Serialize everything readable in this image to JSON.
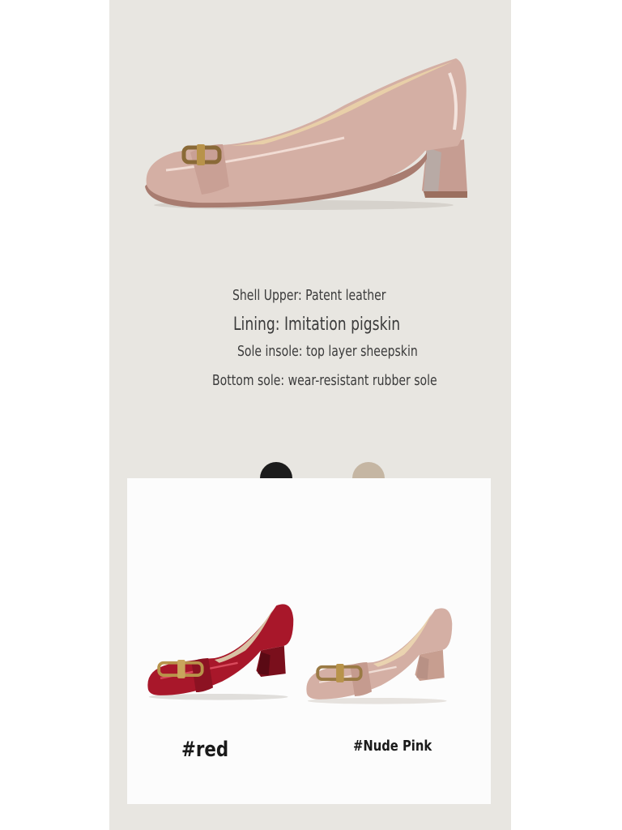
{
  "specs": {
    "shell_upper": "Shell Upper: Patent leather",
    "lining": "Lining: Imitation pigskin",
    "sole_insole": "Sole insole: top layer sheepskin",
    "bottom_sole": "Bottom sole: wear-resistant rubber sole"
  },
  "swatches": [
    {
      "name": "black",
      "color": "#1c1c1c"
    },
    {
      "name": "nude",
      "color": "#c5b6a3"
    }
  ],
  "variants": {
    "red_label": "#red",
    "nude_label": "#Nude Pink"
  },
  "colors": {
    "background": "#e8e6e1",
    "nude_pink": "#d4afa4",
    "red": "#a8172a",
    "gold_buckle": "#b8934a"
  }
}
